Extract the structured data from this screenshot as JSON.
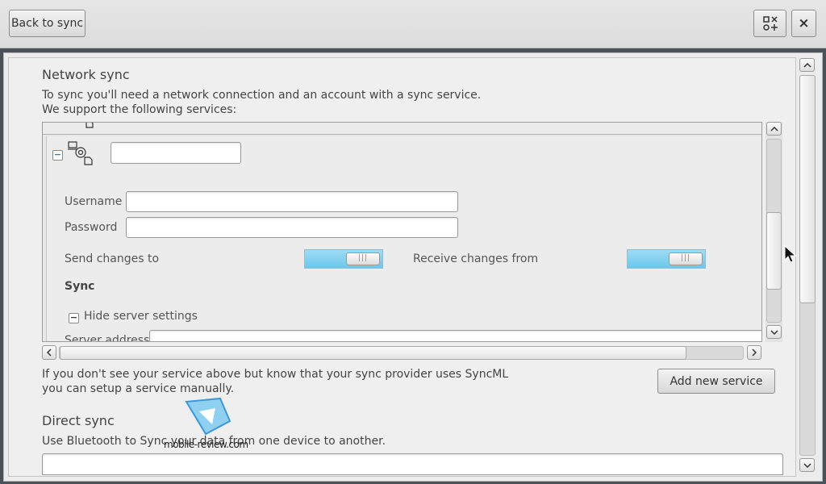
{
  "toolbar": {
    "back_label": "Back to sync",
    "apps_icon": "apps-grid-icon",
    "close_label": "×"
  },
  "network": {
    "title": "Network sync",
    "description_line1": "To sync you'll need a network connection and an account with a sync service.",
    "description_line2": "We support the following services:"
  },
  "service": {
    "collapse_symbol": "−",
    "name_value": "",
    "username_label": "Username",
    "username_value": "",
    "password_label": "Password",
    "password_value": "",
    "send_label": "Send changes to",
    "receive_label": "Receive changes from",
    "send_toggle": "on",
    "receive_toggle": "on",
    "sync_heading": "Sync",
    "hide_server_label": "Hide server settings",
    "server_address_label": "Server address"
  },
  "manual": {
    "line1": "If you don't see your service above but know that your sync provider uses SyncML",
    "line2": "you can setup a service manually.",
    "add_button": "Add new service"
  },
  "direct": {
    "title": "Direct sync",
    "description": "Use Bluetooth to Sync your data from one device to another."
  },
  "watermark": {
    "text": "mobile-review.com"
  },
  "colors": {
    "toggle_on": "#6cc6ec",
    "accent": "#2a80c8"
  }
}
